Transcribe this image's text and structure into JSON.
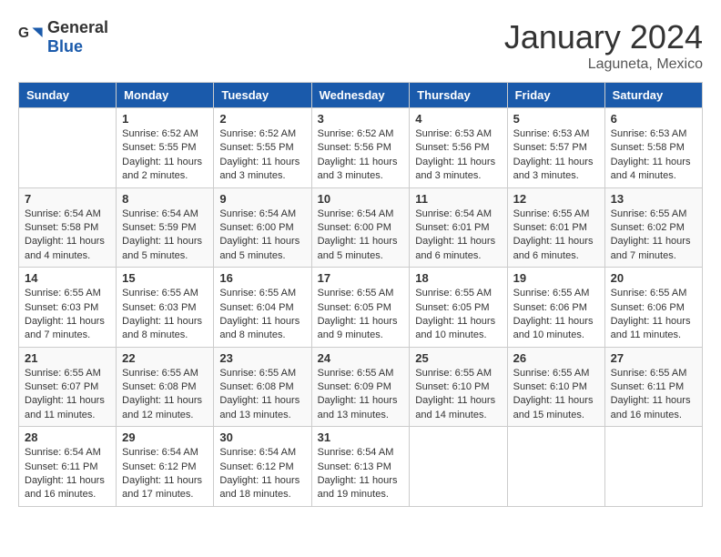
{
  "header": {
    "logo_general": "General",
    "logo_blue": "Blue",
    "month_year": "January 2024",
    "location": "Laguneta, Mexico"
  },
  "weekdays": [
    "Sunday",
    "Monday",
    "Tuesday",
    "Wednesday",
    "Thursday",
    "Friday",
    "Saturday"
  ],
  "weeks": [
    [
      {
        "day": "",
        "info": ""
      },
      {
        "day": "1",
        "info": "Sunrise: 6:52 AM\nSunset: 5:55 PM\nDaylight: 11 hours\nand 2 minutes."
      },
      {
        "day": "2",
        "info": "Sunrise: 6:52 AM\nSunset: 5:55 PM\nDaylight: 11 hours\nand 3 minutes."
      },
      {
        "day": "3",
        "info": "Sunrise: 6:52 AM\nSunset: 5:56 PM\nDaylight: 11 hours\nand 3 minutes."
      },
      {
        "day": "4",
        "info": "Sunrise: 6:53 AM\nSunset: 5:56 PM\nDaylight: 11 hours\nand 3 minutes."
      },
      {
        "day": "5",
        "info": "Sunrise: 6:53 AM\nSunset: 5:57 PM\nDaylight: 11 hours\nand 3 minutes."
      },
      {
        "day": "6",
        "info": "Sunrise: 6:53 AM\nSunset: 5:58 PM\nDaylight: 11 hours\nand 4 minutes."
      }
    ],
    [
      {
        "day": "7",
        "info": "Sunrise: 6:54 AM\nSunset: 5:58 PM\nDaylight: 11 hours\nand 4 minutes."
      },
      {
        "day": "8",
        "info": "Sunrise: 6:54 AM\nSunset: 5:59 PM\nDaylight: 11 hours\nand 5 minutes."
      },
      {
        "day": "9",
        "info": "Sunrise: 6:54 AM\nSunset: 6:00 PM\nDaylight: 11 hours\nand 5 minutes."
      },
      {
        "day": "10",
        "info": "Sunrise: 6:54 AM\nSunset: 6:00 PM\nDaylight: 11 hours\nand 5 minutes."
      },
      {
        "day": "11",
        "info": "Sunrise: 6:54 AM\nSunset: 6:01 PM\nDaylight: 11 hours\nand 6 minutes."
      },
      {
        "day": "12",
        "info": "Sunrise: 6:55 AM\nSunset: 6:01 PM\nDaylight: 11 hours\nand 6 minutes."
      },
      {
        "day": "13",
        "info": "Sunrise: 6:55 AM\nSunset: 6:02 PM\nDaylight: 11 hours\nand 7 minutes."
      }
    ],
    [
      {
        "day": "14",
        "info": "Sunrise: 6:55 AM\nSunset: 6:03 PM\nDaylight: 11 hours\nand 7 minutes."
      },
      {
        "day": "15",
        "info": "Sunrise: 6:55 AM\nSunset: 6:03 PM\nDaylight: 11 hours\nand 8 minutes."
      },
      {
        "day": "16",
        "info": "Sunrise: 6:55 AM\nSunset: 6:04 PM\nDaylight: 11 hours\nand 8 minutes."
      },
      {
        "day": "17",
        "info": "Sunrise: 6:55 AM\nSunset: 6:05 PM\nDaylight: 11 hours\nand 9 minutes."
      },
      {
        "day": "18",
        "info": "Sunrise: 6:55 AM\nSunset: 6:05 PM\nDaylight: 11 hours\nand 10 minutes."
      },
      {
        "day": "19",
        "info": "Sunrise: 6:55 AM\nSunset: 6:06 PM\nDaylight: 11 hours\nand 10 minutes."
      },
      {
        "day": "20",
        "info": "Sunrise: 6:55 AM\nSunset: 6:06 PM\nDaylight: 11 hours\nand 11 minutes."
      }
    ],
    [
      {
        "day": "21",
        "info": "Sunrise: 6:55 AM\nSunset: 6:07 PM\nDaylight: 11 hours\nand 11 minutes."
      },
      {
        "day": "22",
        "info": "Sunrise: 6:55 AM\nSunset: 6:08 PM\nDaylight: 11 hours\nand 12 minutes."
      },
      {
        "day": "23",
        "info": "Sunrise: 6:55 AM\nSunset: 6:08 PM\nDaylight: 11 hours\nand 13 minutes."
      },
      {
        "day": "24",
        "info": "Sunrise: 6:55 AM\nSunset: 6:09 PM\nDaylight: 11 hours\nand 13 minutes."
      },
      {
        "day": "25",
        "info": "Sunrise: 6:55 AM\nSunset: 6:10 PM\nDaylight: 11 hours\nand 14 minutes."
      },
      {
        "day": "26",
        "info": "Sunrise: 6:55 AM\nSunset: 6:10 PM\nDaylight: 11 hours\nand 15 minutes."
      },
      {
        "day": "27",
        "info": "Sunrise: 6:55 AM\nSunset: 6:11 PM\nDaylight: 11 hours\nand 16 minutes."
      }
    ],
    [
      {
        "day": "28",
        "info": "Sunrise: 6:54 AM\nSunset: 6:11 PM\nDaylight: 11 hours\nand 16 minutes."
      },
      {
        "day": "29",
        "info": "Sunrise: 6:54 AM\nSunset: 6:12 PM\nDaylight: 11 hours\nand 17 minutes."
      },
      {
        "day": "30",
        "info": "Sunrise: 6:54 AM\nSunset: 6:12 PM\nDaylight: 11 hours\nand 18 minutes."
      },
      {
        "day": "31",
        "info": "Sunrise: 6:54 AM\nSunset: 6:13 PM\nDaylight: 11 hours\nand 19 minutes."
      },
      {
        "day": "",
        "info": ""
      },
      {
        "day": "",
        "info": ""
      },
      {
        "day": "",
        "info": ""
      }
    ]
  ]
}
